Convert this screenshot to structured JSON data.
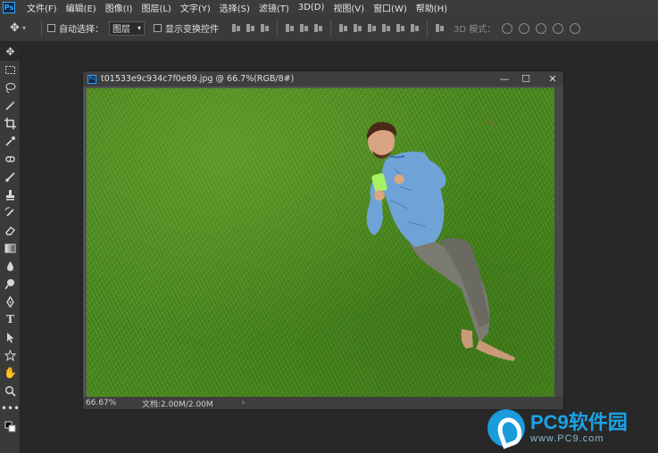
{
  "menubar": {
    "logo": "Ps",
    "items": [
      "文件(F)",
      "编辑(E)",
      "图像(I)",
      "图层(L)",
      "文字(Y)",
      "选择(S)",
      "滤镜(T)",
      "3D(D)",
      "视图(V)",
      "窗口(W)",
      "帮助(H)"
    ]
  },
  "options": {
    "auto_select_label": "自动选择：",
    "auto_select_value": "图层",
    "show_transform_label": "显示变换控件",
    "mode_3d_label": "3D 模式："
  },
  "document": {
    "title": "t01533e9c934c7f0e89.jpg @ 66.7%(RGB/8#)",
    "zoom": "66.67%",
    "doc_info": "文档:2.00M/2.00M",
    "status_arrow": "›"
  },
  "window_controls": {
    "minimize": "—",
    "restore": "☐",
    "close": "✕"
  },
  "watermark": {
    "name": "PC9软件园",
    "url": "www.PC9.com"
  },
  "toolbar": {
    "tools": [
      "move",
      "marquee",
      "lasso",
      "magic-wand",
      "crop",
      "eyedropper",
      "healing",
      "brush",
      "stamp",
      "history-brush",
      "eraser",
      "gradient",
      "blur",
      "dodge",
      "pen",
      "type",
      "path-select",
      "shape",
      "hand",
      "zoom",
      "more"
    ]
  }
}
